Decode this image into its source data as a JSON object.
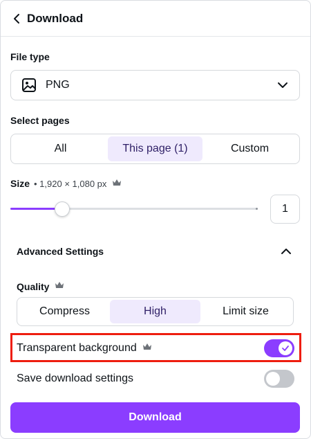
{
  "header": {
    "title": "Download"
  },
  "file_type": {
    "label": "File type",
    "value": "PNG"
  },
  "select_pages": {
    "label": "Select pages",
    "options": [
      "All",
      "This page (1)",
      "Custom"
    ],
    "selected": "This page (1)"
  },
  "size": {
    "label": "Size",
    "dims": "• 1,920 × 1,080 px",
    "slider_value": 0.21,
    "number": "1"
  },
  "advanced": {
    "title": "Advanced Settings"
  },
  "quality": {
    "label": "Quality",
    "options": [
      "Compress",
      "High",
      "Limit size"
    ],
    "selected": "High"
  },
  "transparent_background": {
    "label": "Transparent background",
    "enabled": true
  },
  "save_settings": {
    "label": "Save download settings",
    "enabled": false
  },
  "download_button": {
    "label": "Download"
  },
  "colors": {
    "accent": "#8b3dff",
    "segment_active": "#efeafd",
    "highlight": "#ee1d0f"
  },
  "icons": [
    "back-chevron-icon",
    "image-icon",
    "chevron-down-icon",
    "crown-icon",
    "chevron-up-icon",
    "check-icon"
  ]
}
